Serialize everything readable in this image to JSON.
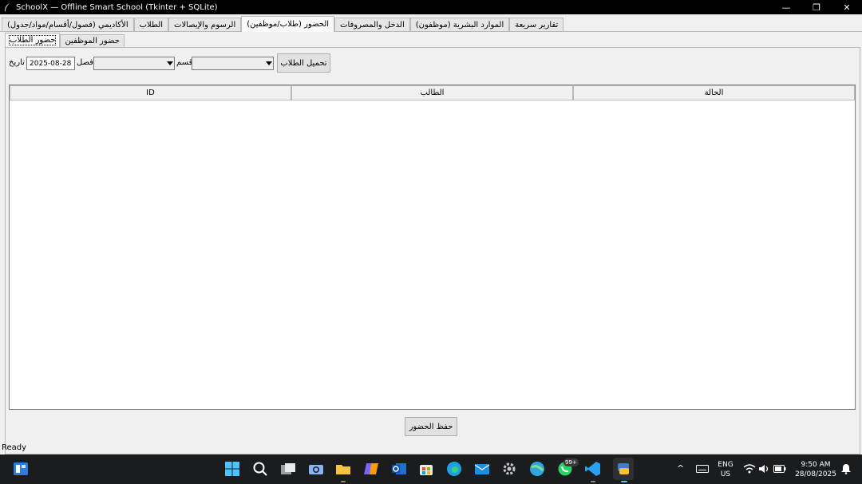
{
  "window": {
    "title": "SchoolX — Offline Smart School (Tkinter + SQLite)",
    "controls": {
      "minimize": "—",
      "maximize": "❐",
      "close": "✕"
    }
  },
  "tabs": [
    {
      "label": "الأكاديمي (فصول/أقسام/مواد/جدول)"
    },
    {
      "label": "الطلاب"
    },
    {
      "label": "الرسوم والإيصالات"
    },
    {
      "label": "الحضور (طلاب/موظفين)"
    },
    {
      "label": "الدخل والمصروفات"
    },
    {
      "label": "الموارد البشرية (موظفون)"
    },
    {
      "label": "تقارير سريعة"
    }
  ],
  "subtabs": [
    {
      "label": "حضور الطلاب"
    },
    {
      "label": "حضور الموظفين"
    }
  ],
  "filters": {
    "date_label": "تاريخ",
    "date_value": "2025-08-28",
    "class_label": "فصل",
    "class_value": "",
    "section_label": "قسم",
    "section_value": "",
    "load_button": "تحميل الطلاب"
  },
  "table": {
    "columns": [
      "ID",
      "الطالب",
      "الحالة"
    ],
    "rows": []
  },
  "save_button": "حفظ الحضور",
  "status": "Ready",
  "taskbar": {
    "badge": "99+",
    "lang_1": "ENG",
    "lang_2": "US",
    "time": "9:50 AM",
    "date": "28/08/2025"
  }
}
